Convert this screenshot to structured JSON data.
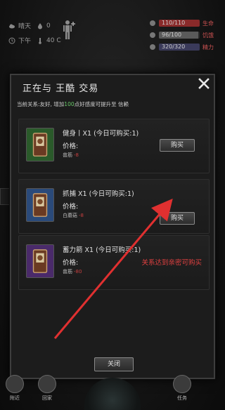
{
  "hud": {
    "weather": "晴天",
    "hunger_value": "0",
    "time_of_day": "下午",
    "temperature": "40 C",
    "stats": [
      {
        "name": "生命",
        "text": "110/110",
        "fraction": 1.0,
        "color": "#8a2a2a"
      },
      {
        "name": "饥饿",
        "text": "96/100",
        "fraction": 0.96,
        "color": "#5a5a5a"
      },
      {
        "name": "精力",
        "text": "320/320",
        "fraction": 1.0,
        "color": "#3a3a5a"
      }
    ]
  },
  "dialog": {
    "title": "正在与 王酷 交易",
    "relation_prefix": "当前关系:友好, 增加",
    "relation_num": "100",
    "relation_suffix": "点好感度可提升至 信赖",
    "price_label": "价格:",
    "buy_label": "购买",
    "close_label": "关闭",
    "items": [
      {
        "name": "健身丨X1  (今日可购买:1)",
        "price_item": "兽筋",
        "price_qty": "-8",
        "color": "#2a5a2a",
        "buyable": true
      },
      {
        "name": "抓捕 X1  (今日可购买:1)",
        "price_item": "白蘑菇",
        "price_qty": "-8",
        "color": "#2a4a7a",
        "buyable": true
      },
      {
        "name": "蓄力箭 X1  (今日可购买:1)",
        "price_item": "兽筋",
        "price_qty": "-80",
        "color": "#4a2a6a",
        "buyable": false,
        "locked_note": "关系达到亲密可购买"
      }
    ]
  },
  "nav": {
    "nearby": "附近",
    "home": "回家",
    "task": "任务"
  },
  "colors": {
    "annotation_arrow": "#e03030",
    "locked_text": "#e04040"
  }
}
